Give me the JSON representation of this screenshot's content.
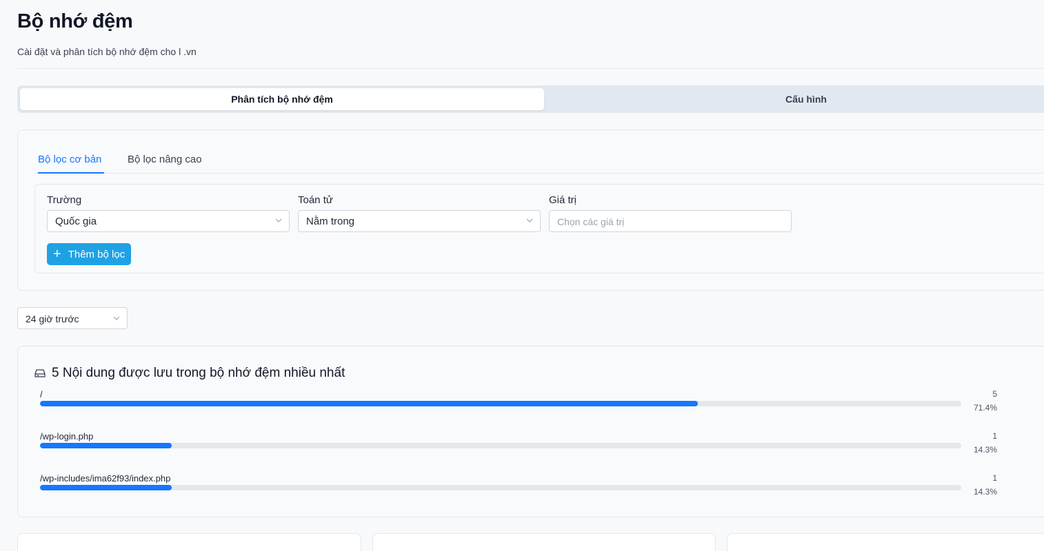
{
  "header": {
    "title": "Bộ nhớ đệm",
    "subtitle": "Cài đặt và phân tích bộ nhớ đệm cho l           .vn"
  },
  "segment_tabs": [
    {
      "label": "Phân tích bộ nhớ đệm",
      "active": true
    },
    {
      "label": "Cấu hình",
      "active": false
    }
  ],
  "filter": {
    "tabs": [
      {
        "label": "Bộ lọc cơ bản",
        "active": true
      },
      {
        "label": "Bộ lọc nâng cao",
        "active": false
      }
    ],
    "field_label": "Trường",
    "field_value": "Quốc gia",
    "operator_label": "Toán tử",
    "operator_value": "Nằm trong",
    "value_label": "Giá trị",
    "value_placeholder": "Chọn các giá trị",
    "add_button": "Thêm bộ lọc"
  },
  "time_range": {
    "value": "24 giờ trước"
  },
  "top_cached": {
    "title": "5 Nội dung được lưu trong bộ nhớ đệm nhiều nhất",
    "items": [
      {
        "path": "/",
        "count": "5",
        "percent": "71.4%",
        "fraction": 0.714
      },
      {
        "path": "/wp-login.php",
        "count": "1",
        "percent": "14.3%",
        "fraction": 0.143
      },
      {
        "path": "/wp-includes/ima62f93/index.php",
        "count": "1",
        "percent": "14.3%",
        "fraction": 0.143
      }
    ]
  },
  "colors": {
    "accent": "#1677ff",
    "add_button": "#1fa2e4"
  }
}
